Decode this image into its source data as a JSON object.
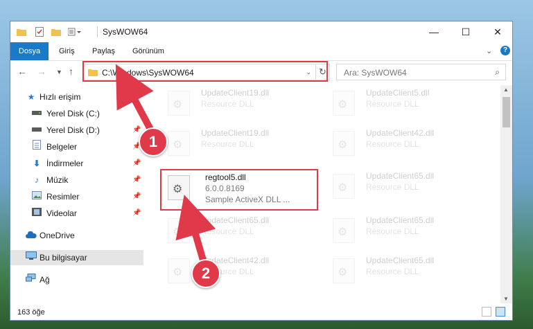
{
  "window": {
    "title": "SysWOW64",
    "controls": {
      "minimize": "—",
      "maximize": "☐",
      "close": "✕"
    }
  },
  "ribbon": {
    "tabs": [
      {
        "label": "Dosya",
        "active": true
      },
      {
        "label": "Giriş"
      },
      {
        "label": "Paylaş"
      },
      {
        "label": "Görünüm"
      }
    ]
  },
  "nav": {
    "address": "C:\\Windows\\SysWOW64",
    "search_placeholder": "Ara: SysWOW64"
  },
  "sidebar": {
    "items": [
      {
        "label": "Hızlı erişim",
        "icon": "star-icon"
      },
      {
        "label": "Yerel Disk (C:)",
        "icon": "drive-icon",
        "pinned": true
      },
      {
        "label": "Yerel Disk (D:)",
        "icon": "drive-icon",
        "pinned": true
      },
      {
        "label": "Belgeler",
        "icon": "documents-icon",
        "pinned": true
      },
      {
        "label": "İndirmeler",
        "icon": "download-icon",
        "pinned": true
      },
      {
        "label": "Müzik",
        "icon": "music-icon",
        "pinned": true
      },
      {
        "label": "Resimler",
        "icon": "pictures-icon",
        "pinned": true
      },
      {
        "label": "Videolar",
        "icon": "videos-icon",
        "pinned": true
      },
      {
        "label": "OneDrive",
        "icon": "cloud-icon"
      },
      {
        "label": "Bu bilgisayar",
        "icon": "computer-icon",
        "selected": true
      },
      {
        "label": "Ağ",
        "icon": "network-icon"
      }
    ]
  },
  "files": {
    "left": [
      {
        "name": "UpdateClient19.dll",
        "type": "Resource DLL"
      },
      {
        "name": "UpdateClient19.dll",
        "type": "Resource DLL"
      },
      {
        "name": "regtool5.dll",
        "version": "6.0.0.8169",
        "description": "Sample ActiveX DLL ..."
      },
      {
        "name": "UpdateClient65.dll",
        "type": "Resource DLL"
      },
      {
        "name": "UpdateClient42.dll",
        "type": "Resource DLL"
      }
    ],
    "right": [
      {
        "name": "UpdateClient5.dll",
        "type": "Resource DLL"
      },
      {
        "name": "UpdateClient42.dll",
        "type": "Resource DLL"
      },
      {
        "name": "UpdateClient65.dll",
        "type": "Resource DLL"
      },
      {
        "name": "UpdateClient65.dll",
        "type": "Resource DLL"
      },
      {
        "name": "UpdateClient65.dll",
        "type": "Resource DLL"
      }
    ]
  },
  "status": {
    "item_count": "163 öğe"
  },
  "annotations": {
    "step1": "1",
    "step2": "2",
    "color": "#e0394a"
  }
}
